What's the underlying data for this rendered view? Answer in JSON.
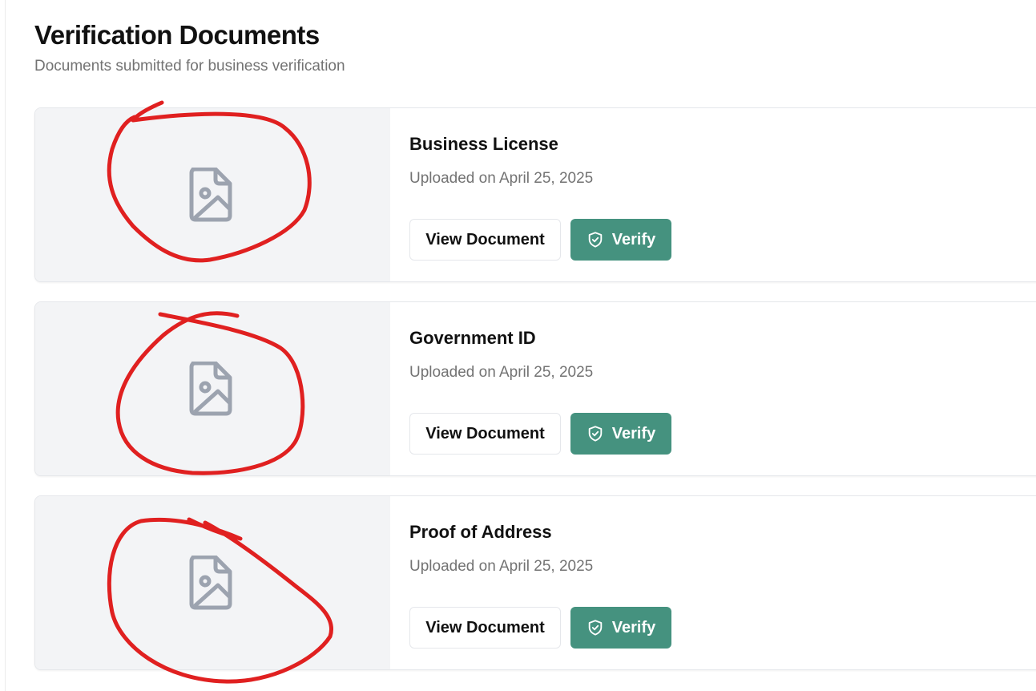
{
  "page": {
    "title": "Verification Documents",
    "subtitle": "Documents submitted for business verification"
  },
  "documents": [
    {
      "name": "Business License",
      "uploaded": "Uploaded on April 25, 2025",
      "view_label": "View Document",
      "verify_label": "Verify",
      "thumbnail_icon": "file-image-icon"
    },
    {
      "name": "Government ID",
      "uploaded": "Uploaded on April 25, 2025",
      "view_label": "View Document",
      "verify_label": "Verify",
      "thumbnail_icon": "file-image-icon"
    },
    {
      "name": "Proof of Address",
      "uploaded": "Uploaded on April 25, 2025",
      "view_label": "View Document",
      "verify_label": "Verify",
      "thumbnail_icon": "file-image-icon"
    }
  ],
  "colors": {
    "accent": "#45927f",
    "thumbnail_bg": "#f3f4f6",
    "icon": "#9ca3af",
    "annotation": "#e02020"
  }
}
